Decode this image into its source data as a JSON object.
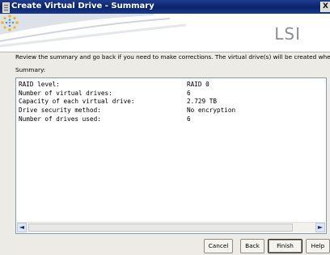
{
  "window": {
    "title": "Create Virtual Drive - Summary",
    "close_glyph": "X"
  },
  "banner": {
    "logo_text": "LSI",
    "logo_icon": "lsi-starburst-icon"
  },
  "instruction": "Review the summary and go back if you need to make corrections. The virtual drive(s) will be created when you click finish.",
  "summary": {
    "label": "Summary:",
    "rows": [
      {
        "key": "RAID level:",
        "value": "RAID 0"
      },
      {
        "key": "Number of virtual drives:",
        "value": "6"
      },
      {
        "key": "Capacity of each virtual drive:",
        "value": "2.729 TB"
      },
      {
        "key": "Drive security method:",
        "value": "No encryption"
      },
      {
        "key": "Number of drives used:",
        "value": "6"
      }
    ]
  },
  "scrollbar": {
    "left_glyph": "◄",
    "right_glyph": "►"
  },
  "buttons": {
    "cancel": "Cancel",
    "back": "Back",
    "finish": "Finish",
    "help": "Help"
  },
  "colors": {
    "titlebar": "#0a246a",
    "dialog_background": "#ecebe6",
    "summary_border": "#7f9db9"
  }
}
